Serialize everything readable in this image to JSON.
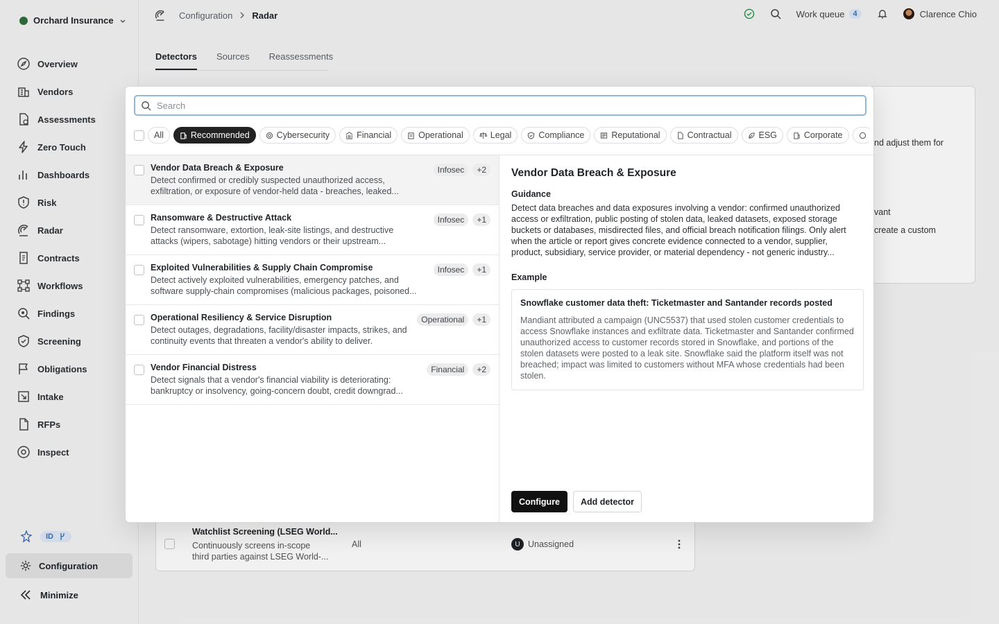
{
  "org": {
    "name": "Orchard Insurance"
  },
  "sidebar": {
    "items": [
      {
        "label": "Overview",
        "icon": "compass-icon"
      },
      {
        "label": "Vendors",
        "icon": "building-icon"
      },
      {
        "label": "Assessments",
        "icon": "document-check-icon"
      },
      {
        "label": "Zero Touch",
        "icon": "bolt-icon"
      },
      {
        "label": "Dashboards",
        "icon": "bar-chart-icon"
      },
      {
        "label": "Risk",
        "icon": "shield-icon"
      },
      {
        "label": "Radar",
        "icon": "radar-icon"
      },
      {
        "label": "Contracts",
        "icon": "contract-icon"
      },
      {
        "label": "Workflows",
        "icon": "workflow-icon"
      },
      {
        "label": "Findings",
        "icon": "findings-icon"
      },
      {
        "label": "Screening",
        "icon": "shield-check-icon"
      },
      {
        "label": "Obligations",
        "icon": "flag-icon"
      },
      {
        "label": "Intake",
        "icon": "intake-icon"
      },
      {
        "label": "RFPs",
        "icon": "rfp-icon"
      },
      {
        "label": "Inspect",
        "icon": "eye-icon"
      }
    ],
    "badge_label": "ID",
    "configuration": "Configuration",
    "minimize": "Minimize"
  },
  "header": {
    "breadcrumb_parent": "Configuration",
    "breadcrumb_current": "Radar",
    "work_queue_label": "Work queue",
    "work_queue_count": "4",
    "user_name": "Clarence Chio"
  },
  "tabs": [
    "Detectors",
    "Sources",
    "Reassessments"
  ],
  "background": {
    "card_text_1": "nd adjust them for",
    "card_text_2": "vant",
    "card_text_3": "create a custom",
    "row_title": "Watchlist Screening (LSEG World...",
    "row_desc_1": "Continuously screens in-scope",
    "row_desc_2": "third parties against LSEG World-...",
    "row_scope": "All",
    "row_assignee_initial": "U",
    "row_assignee": "Unassigned"
  },
  "modal": {
    "search_placeholder": "Search",
    "filters": [
      {
        "label": "All",
        "active": false
      },
      {
        "label": "Recommended",
        "active": true
      },
      {
        "label": "Cybersecurity",
        "active": false
      },
      {
        "label": "Financial",
        "active": false
      },
      {
        "label": "Operational",
        "active": false
      },
      {
        "label": "Legal",
        "active": false
      },
      {
        "label": "Compliance",
        "active": false
      },
      {
        "label": "Reputational",
        "active": false
      },
      {
        "label": "Contractual",
        "active": false
      },
      {
        "label": "ESG",
        "active": false
      },
      {
        "label": "Corporate",
        "active": false
      }
    ],
    "detectors": [
      {
        "title": "Vendor Data Breach & Exposure",
        "desc": "Detect confirmed or credibly suspected unauthorized access, exfiltration, or exposure of vendor-held data - breaches, leaked...",
        "tag": "Infosec",
        "more": "+2"
      },
      {
        "title": "Ransomware & Destructive Attack",
        "desc": "Detect ransomware, extortion, leak-site listings, and destructive attacks (wipers, sabotage) hitting vendors or their upstream...",
        "tag": "Infosec",
        "more": "+1"
      },
      {
        "title": "Exploited Vulnerabilities & Supply Chain Compromise",
        "desc": "Detect actively exploited vulnerabilities, emergency patches, and software supply-chain compromises (malicious packages, poisoned...",
        "tag": "Infosec",
        "more": "+1"
      },
      {
        "title": "Operational Resiliency & Service Disruption",
        "desc": "Detect outages, degradations, facility/disaster impacts, strikes, and continuity events that threaten a vendor's ability to deliver.",
        "tag": "Operational",
        "more": "+1"
      },
      {
        "title": "Vendor Financial Distress",
        "desc": "Detect signals that a vendor's financial viability is deteriorating: bankruptcy or insolvency, going-concern doubt, credit downgrad...",
        "tag": "Financial",
        "more": "+2"
      }
    ],
    "detail": {
      "title": "Vendor Data Breach & Exposure",
      "guidance_label": "Guidance",
      "guidance": "Detect data breaches and data exposures involving a vendor: confirmed unauthorized access or exfiltration, public posting of stolen data, leaked datasets, exposed storage buckets or databases, misdirected files, and official breach notification filings. Only alert when the article or report gives concrete evidence connected to a vendor, supplier, product, subsidiary, service provider, or material dependency - not generic industry...",
      "example_label": "Example",
      "example_title": "Snowflake customer data theft: Ticketmaster and Santander records posted",
      "example_body": "Mandiant attributed a campaign (UNC5537) that used stolen customer credentials to access Snowflake instances and exfiltrate data. Ticketmaster and Santander confirmed unauthorized access to customer records stored in Snowflake, and portions of the stolen datasets were posted to a leak site. Snowflake said the platform itself was not breached; impact was limited to customers without MFA whose credentials had been stolen.",
      "configure_label": "Configure",
      "add_label": "Add detector"
    }
  }
}
